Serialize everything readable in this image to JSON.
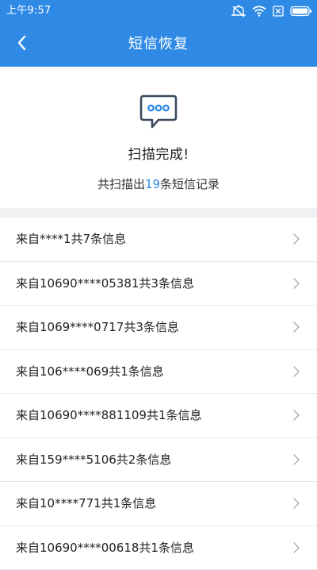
{
  "status_bar": {
    "time": "上午9:57",
    "icons": [
      "mute-icon",
      "wifi-icon",
      "sim-off-icon",
      "battery-icon"
    ]
  },
  "app_bar": {
    "title": "短信恢复",
    "back_icon": "chevron-left-icon"
  },
  "summary": {
    "icon": "message-bubble-icon",
    "title": "扫描完成!",
    "count_prefix": "共扫描出",
    "count_value": "19",
    "count_suffix": "条短信记录"
  },
  "sms_groups": [
    {
      "label": "来自****1共7条信息"
    },
    {
      "label": "来自10690****05381共3条信息"
    },
    {
      "label": "来自1069****0717共3条信息"
    },
    {
      "label": "来自106****069共1条信息"
    },
    {
      "label": "来自10690****881109共1条信息"
    },
    {
      "label": "来自159****5106共2条信息"
    },
    {
      "label": "来自10****771共1条信息"
    },
    {
      "label": "来自10690****00618共1条信息"
    }
  ],
  "colors": {
    "primary": "#2f8ae6",
    "background": "#ffffff",
    "divider_gap": "#f1f1f4",
    "chevron": "#b0b0b0"
  }
}
